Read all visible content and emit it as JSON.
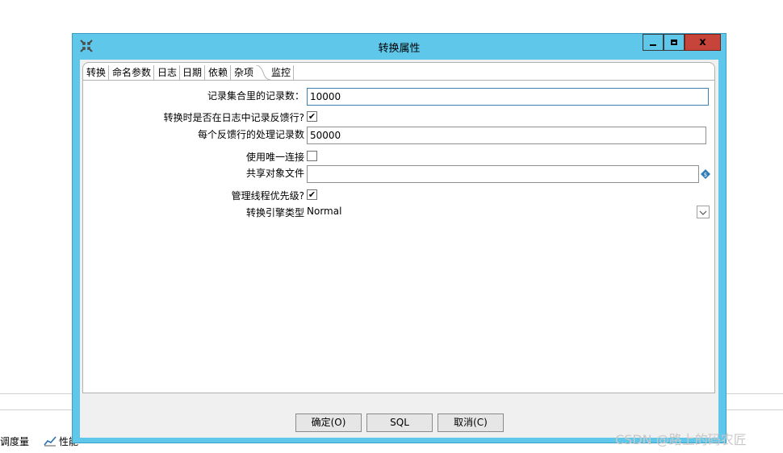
{
  "window": {
    "title": "转换属性",
    "colors": {
      "frame": "#5ec7ea",
      "close": "#c7443a"
    }
  },
  "tabs": [
    {
      "label": "转换",
      "active": false
    },
    {
      "label": "命名参数",
      "active": false
    },
    {
      "label": "日志",
      "active": false
    },
    {
      "label": "日期",
      "active": false
    },
    {
      "label": "依赖",
      "active": false
    },
    {
      "label": "杂项",
      "active": true
    },
    {
      "label": "监控",
      "active": false
    }
  ],
  "fields": {
    "record_count": {
      "label": "记录集合里的记录数：",
      "value": "10000"
    },
    "log_feedback": {
      "label": "转换时是否在日志中记录反馈行?",
      "checked": true
    },
    "feedback_size": {
      "label": "每个反馈行的处理记录数",
      "value": "50000"
    },
    "unique_connections": {
      "label": "使用唯一连接",
      "checked": false
    },
    "shared_objects": {
      "label": "共享对象文件",
      "value": ""
    },
    "thread_priority": {
      "label": "管理线程优先级?",
      "checked": true
    },
    "engine_type": {
      "label": "转换引擎类型",
      "value": "Normal"
    }
  },
  "buttons": {
    "ok": "确定(O)",
    "sql": "SQL",
    "cancel": "取消(C)"
  },
  "background": {
    "tab1": "调度量",
    "tab2": "性能"
  },
  "watermark": "CSDN @路上的码农匠"
}
